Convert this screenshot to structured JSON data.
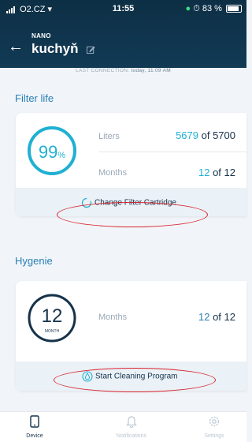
{
  "status": {
    "carrier": "O2.CZ",
    "time": "11:55",
    "battery": "83 %"
  },
  "header": {
    "category": "NANO",
    "title": "kuchyň"
  },
  "last_connection": {
    "label": "LAST CONNECTION:",
    "value": "today, 11:09 AM"
  },
  "filter": {
    "section_label": "Filter life",
    "percent": "99",
    "percent_unit": "%",
    "percent_value": 0.99,
    "liters_label": "Liters",
    "liters_current": "5679",
    "liters_total": "of 5700",
    "months_label": "Months",
    "months_current": "12",
    "months_total": "of 12",
    "action": "Change Filter Cartridge"
  },
  "hygiene": {
    "section_label": "Hygenie",
    "months_value": "12",
    "months_unit": "MONTH",
    "months_label": "Months",
    "months_current": "12",
    "months_total": "of 12",
    "action": "Start Cleaning Program"
  },
  "tabs": [
    {
      "label": "Device",
      "icon": "phone-icon"
    },
    {
      "label": "Notifications",
      "icon": "bell-icon"
    },
    {
      "label": "Settings",
      "icon": "gear-icon"
    }
  ],
  "colors": {
    "header": "#0d2f45",
    "accent": "#1fb0d2",
    "highlight": "#d9252f"
  }
}
